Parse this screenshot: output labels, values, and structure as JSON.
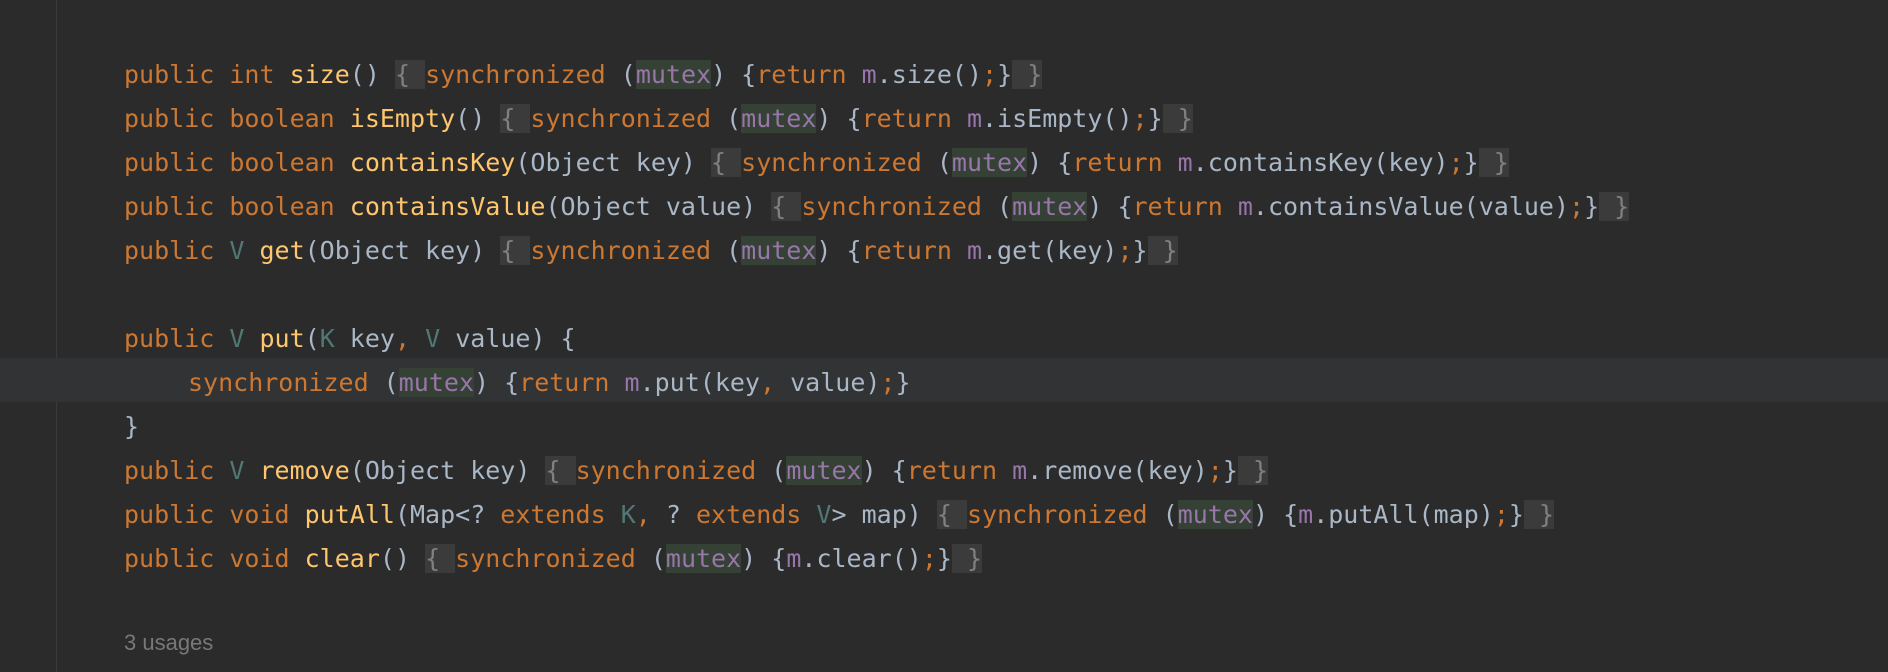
{
  "colors": {
    "background": "#2b2b2b",
    "keyword": "#cc7832",
    "method": "#ffc66d",
    "default_text": "#a9b7c6",
    "field": "#9876aa",
    "type_param": "#507874",
    "mutex_highlight": "#344134",
    "fold_background": "#3b3b3b"
  },
  "code_lines": [
    [
      {
        "t": "public ",
        "c": "kw"
      },
      {
        "t": "int ",
        "c": "kw"
      },
      {
        "t": "size",
        "c": "fn"
      },
      {
        "t": "()",
        "c": ""
      },
      {
        "t": " ",
        "c": ""
      },
      {
        "t": "{ ",
        "c": "fold"
      },
      {
        "t": "synchronized ",
        "c": "kw"
      },
      {
        "t": "(",
        "c": ""
      },
      {
        "t": "mutex",
        "c": "mut"
      },
      {
        "t": ") {",
        "c": ""
      },
      {
        "t": "return ",
        "c": "kw"
      },
      {
        "t": "m",
        "c": "fld"
      },
      {
        "t": ".size()",
        "c": ""
      },
      {
        "t": ";",
        "c": "kw"
      },
      {
        "t": "}",
        "c": ""
      },
      {
        "t": " }",
        "c": "fold"
      }
    ],
    [
      {
        "t": "public ",
        "c": "kw"
      },
      {
        "t": "boolean ",
        "c": "kw"
      },
      {
        "t": "isEmpty",
        "c": "fn"
      },
      {
        "t": "()",
        "c": ""
      },
      {
        "t": " ",
        "c": ""
      },
      {
        "t": "{ ",
        "c": "fold"
      },
      {
        "t": "synchronized ",
        "c": "kw"
      },
      {
        "t": "(",
        "c": ""
      },
      {
        "t": "mutex",
        "c": "mut"
      },
      {
        "t": ") {",
        "c": ""
      },
      {
        "t": "return ",
        "c": "kw"
      },
      {
        "t": "m",
        "c": "fld"
      },
      {
        "t": ".isEmpty()",
        "c": ""
      },
      {
        "t": ";",
        "c": "kw"
      },
      {
        "t": "}",
        "c": ""
      },
      {
        "t": " }",
        "c": "fold"
      }
    ],
    [
      {
        "t": "public ",
        "c": "kw"
      },
      {
        "t": "boolean ",
        "c": "kw"
      },
      {
        "t": "containsKey",
        "c": "fn"
      },
      {
        "t": "(Object key)",
        "c": ""
      },
      {
        "t": " ",
        "c": ""
      },
      {
        "t": "{ ",
        "c": "fold"
      },
      {
        "t": "synchronized ",
        "c": "kw"
      },
      {
        "t": "(",
        "c": ""
      },
      {
        "t": "mutex",
        "c": "mut"
      },
      {
        "t": ") {",
        "c": ""
      },
      {
        "t": "return ",
        "c": "kw"
      },
      {
        "t": "m",
        "c": "fld"
      },
      {
        "t": ".containsKey(key)",
        "c": ""
      },
      {
        "t": ";",
        "c": "kw"
      },
      {
        "t": "}",
        "c": ""
      },
      {
        "t": " }",
        "c": "fold"
      }
    ],
    [
      {
        "t": "public ",
        "c": "kw"
      },
      {
        "t": "boolean ",
        "c": "kw"
      },
      {
        "t": "containsValue",
        "c": "fn"
      },
      {
        "t": "(Object value)",
        "c": ""
      },
      {
        "t": " ",
        "c": ""
      },
      {
        "t": "{ ",
        "c": "fold"
      },
      {
        "t": "synchronized ",
        "c": "kw"
      },
      {
        "t": "(",
        "c": ""
      },
      {
        "t": "mutex",
        "c": "mut"
      },
      {
        "t": ") {",
        "c": ""
      },
      {
        "t": "return ",
        "c": "kw"
      },
      {
        "t": "m",
        "c": "fld"
      },
      {
        "t": ".containsValue(value)",
        "c": ""
      },
      {
        "t": ";",
        "c": "kw"
      },
      {
        "t": "}",
        "c": ""
      },
      {
        "t": " }",
        "c": "fold"
      }
    ],
    [
      {
        "t": "public ",
        "c": "kw"
      },
      {
        "t": "V ",
        "c": "tp"
      },
      {
        "t": "get",
        "c": "fn"
      },
      {
        "t": "(Object key)",
        "c": ""
      },
      {
        "t": " ",
        "c": ""
      },
      {
        "t": "{ ",
        "c": "fold"
      },
      {
        "t": "synchronized ",
        "c": "kw"
      },
      {
        "t": "(",
        "c": ""
      },
      {
        "t": "mutex",
        "c": "mut"
      },
      {
        "t": ") {",
        "c": ""
      },
      {
        "t": "return ",
        "c": "kw"
      },
      {
        "t": "m",
        "c": "fld"
      },
      {
        "t": ".get(key)",
        "c": ""
      },
      {
        "t": ";",
        "c": "kw"
      },
      {
        "t": "}",
        "c": ""
      },
      {
        "t": " }",
        "c": "fold"
      }
    ],
    [],
    [
      {
        "t": "public ",
        "c": "kw"
      },
      {
        "t": "V ",
        "c": "tp"
      },
      {
        "t": "put",
        "c": "fn"
      },
      {
        "t": "(",
        "c": ""
      },
      {
        "t": "K",
        "c": "tp"
      },
      {
        "t": " key",
        "c": ""
      },
      {
        "t": ", ",
        "c": "kw"
      },
      {
        "t": "V",
        "c": "tp"
      },
      {
        "t": " value) {",
        "c": ""
      }
    ],
    [
      {
        "t": "",
        "c": "indent"
      },
      {
        "t": "synchronized ",
        "c": "kw"
      },
      {
        "t": "(",
        "c": ""
      },
      {
        "t": "mutex",
        "c": "mut"
      },
      {
        "t": ") {",
        "c": ""
      },
      {
        "t": "return ",
        "c": "kw"
      },
      {
        "t": "m",
        "c": "fld"
      },
      {
        "t": ".put(key",
        "c": ""
      },
      {
        "t": ", ",
        "c": "kw"
      },
      {
        "t": "value)",
        "c": ""
      },
      {
        "t": ";",
        "c": "kw"
      },
      {
        "t": "}",
        "c": ""
      }
    ],
    [
      {
        "t": "}",
        "c": ""
      }
    ],
    [
      {
        "t": "public ",
        "c": "kw"
      },
      {
        "t": "V ",
        "c": "tp"
      },
      {
        "t": "remove",
        "c": "fn"
      },
      {
        "t": "(Object key)",
        "c": ""
      },
      {
        "t": " ",
        "c": ""
      },
      {
        "t": "{ ",
        "c": "fold"
      },
      {
        "t": "synchronized ",
        "c": "kw"
      },
      {
        "t": "(",
        "c": ""
      },
      {
        "t": "mutex",
        "c": "mut"
      },
      {
        "t": ") {",
        "c": ""
      },
      {
        "t": "return ",
        "c": "kw"
      },
      {
        "t": "m",
        "c": "fld"
      },
      {
        "t": ".remove(key)",
        "c": ""
      },
      {
        "t": ";",
        "c": "kw"
      },
      {
        "t": "}",
        "c": ""
      },
      {
        "t": " }",
        "c": "fold"
      }
    ],
    [
      {
        "t": "public ",
        "c": "kw"
      },
      {
        "t": "void ",
        "c": "kw"
      },
      {
        "t": "putAll",
        "c": "fn"
      },
      {
        "t": "(Map<? ",
        "c": ""
      },
      {
        "t": "extends ",
        "c": "kw"
      },
      {
        "t": "K",
        "c": "tp"
      },
      {
        "t": ", ",
        "c": "kw"
      },
      {
        "t": "? ",
        "c": ""
      },
      {
        "t": "extends ",
        "c": "kw"
      },
      {
        "t": "V",
        "c": "tp"
      },
      {
        "t": "> map)",
        "c": ""
      },
      {
        "t": " ",
        "c": ""
      },
      {
        "t": "{ ",
        "c": "fold"
      },
      {
        "t": "synchronized ",
        "c": "kw"
      },
      {
        "t": "(",
        "c": ""
      },
      {
        "t": "mutex",
        "c": "mut"
      },
      {
        "t": ") {",
        "c": ""
      },
      {
        "t": "m",
        "c": "fld"
      },
      {
        "t": ".putAll(map)",
        "c": ""
      },
      {
        "t": ";",
        "c": "kw"
      },
      {
        "t": "}",
        "c": ""
      },
      {
        "t": " }",
        "c": "fold"
      }
    ],
    [
      {
        "t": "public ",
        "c": "kw"
      },
      {
        "t": "void ",
        "c": "kw"
      },
      {
        "t": "clear",
        "c": "fn"
      },
      {
        "t": "()",
        "c": ""
      },
      {
        "t": " ",
        "c": ""
      },
      {
        "t": "{ ",
        "c": "fold"
      },
      {
        "t": "synchronized ",
        "c": "kw"
      },
      {
        "t": "(",
        "c": ""
      },
      {
        "t": "mutex",
        "c": "mut"
      },
      {
        "t": ") {",
        "c": ""
      },
      {
        "t": "m",
        "c": "fld"
      },
      {
        "t": ".clear()",
        "c": ""
      },
      {
        "t": ";",
        "c": "kw"
      },
      {
        "t": "}",
        "c": ""
      },
      {
        "t": " }",
        "c": "fold"
      }
    ]
  ],
  "usages_hint": "3 usages"
}
